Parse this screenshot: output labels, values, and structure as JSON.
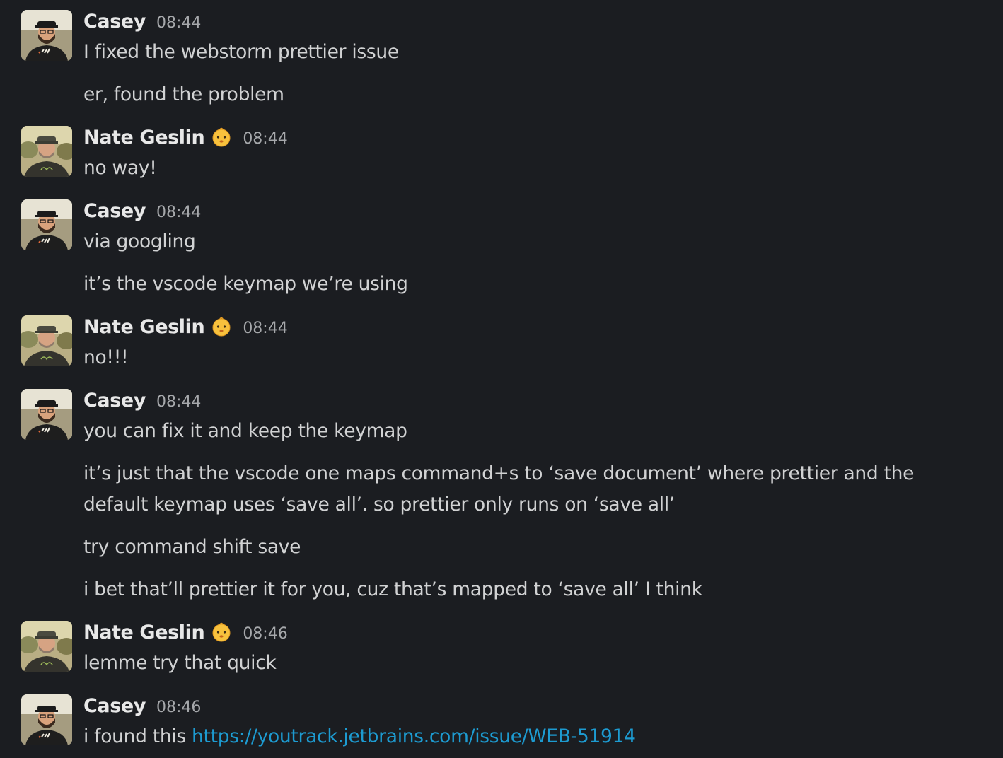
{
  "users": {
    "casey": {
      "name": "Casey"
    },
    "nate": {
      "name": "Nate Geslin",
      "status_emoji": "baby-face-emoji"
    }
  },
  "messages": [
    {
      "author": "Casey",
      "time": "08:44",
      "lines": [
        "I fixed the webstorm prettier issue",
        "er, found the problem"
      ]
    },
    {
      "author": "Nate Geslin",
      "time": "08:44",
      "lines": [
        "no way!"
      ]
    },
    {
      "author": "Casey",
      "time": "08:44",
      "lines": [
        "via googling",
        "it’s the vscode keymap we’re using"
      ]
    },
    {
      "author": "Nate Geslin",
      "time": "08:44",
      "lines": [
        "no!!!"
      ]
    },
    {
      "author": "Casey",
      "time": "08:44",
      "lines": [
        "you can fix it and keep the keymap",
        "it’s just that the vscode one maps command+s to ‘save document’ where prettier and the default keymap uses ‘save all’.  so prettier only runs on ‘save all’",
        "try command shift save",
        "i bet that’ll prettier it for you, cuz that’s mapped to ‘save all’ I think"
      ]
    },
    {
      "author": "Nate Geslin",
      "time": "08:46",
      "lines": [
        "lemme try that quick"
      ]
    },
    {
      "author": "Casey",
      "time": "08:46",
      "lines": [
        {
          "text": "i found this ",
          "link": "https://youtrack.jetbrains.com/issue/WEB-51914"
        }
      ]
    }
  ]
}
